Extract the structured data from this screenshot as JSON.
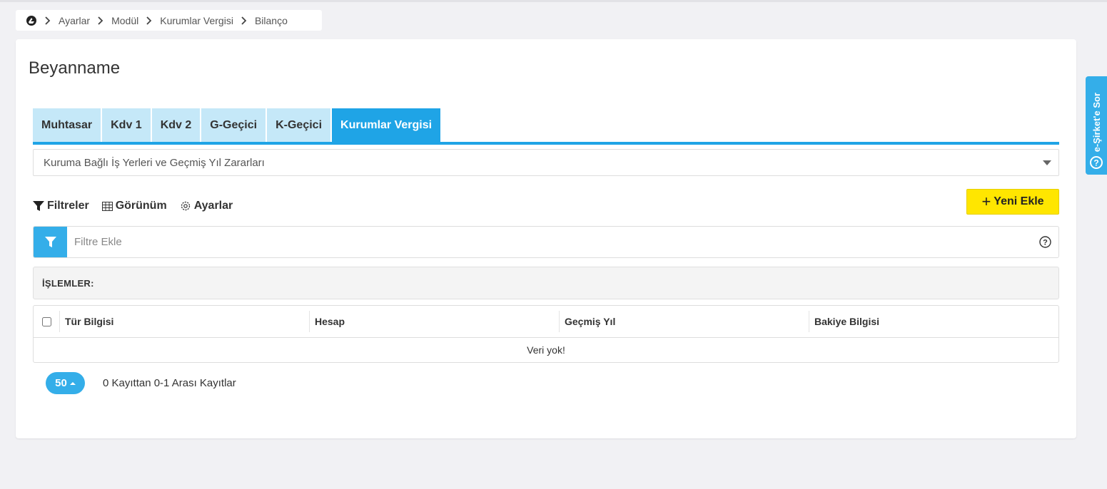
{
  "breadcrumb": {
    "items": [
      "Ayarlar",
      "Modül",
      "Kurumlar Vergisi",
      "Bilanço"
    ]
  },
  "page": {
    "title": "Beyanname"
  },
  "tabs": [
    {
      "label": "Muhtasar",
      "active": false
    },
    {
      "label": "Kdv 1",
      "active": false
    },
    {
      "label": "Kdv 2",
      "active": false
    },
    {
      "label": "G-Geçici",
      "active": false
    },
    {
      "label": "K-Geçici",
      "active": false
    },
    {
      "label": "Kurumlar Vergisi",
      "active": true
    }
  ],
  "select": {
    "value": "Kuruma Bağlı İş Yerleri ve Geçmiş Yıl Zararları"
  },
  "toolbar": {
    "filters_label": "Filtreler",
    "view_label": "Görünüm",
    "settings_label": "Ayarlar",
    "new_label": "Yeni Ekle"
  },
  "filter": {
    "placeholder": "Filtre Ekle",
    "value": ""
  },
  "operations": {
    "label": "İŞLEMLER:"
  },
  "table": {
    "columns": [
      "Tür Bilgisi",
      "Hesap",
      "Geçmiş Yıl",
      "Bakiye Bilgisi"
    ],
    "rows": [],
    "empty_message": "Veri yok!"
  },
  "pagination": {
    "page_size": "50",
    "summary": "0 Kayıttan 0-1 Arası Kayıtlar"
  },
  "side_tab": {
    "label": "e-Şirket'e Sor"
  },
  "colors": {
    "accent": "#1fa4e6",
    "tab_inactive": "#c5e8f8",
    "new_button": "#ffe600",
    "background": "#f1f1f4"
  }
}
